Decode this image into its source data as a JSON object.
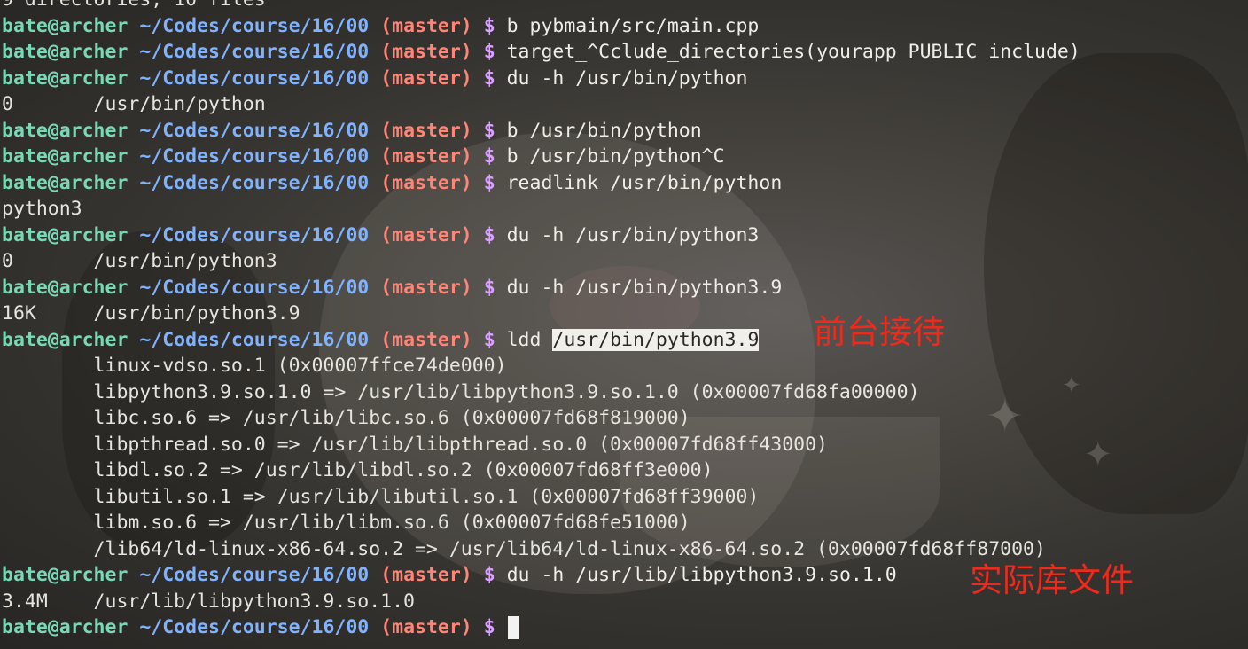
{
  "prompt": {
    "user": "bate@archer",
    "path": "~/Codes/course/16/00",
    "branch": "(master)",
    "symbol": "$"
  },
  "partial_top_line": "9 directories, 10 files",
  "lines": [
    {
      "type": "prompt",
      "cmd": "b pybmain/src/main.cpp"
    },
    {
      "type": "prompt",
      "cmd": "target_^Cclude_directories(yourapp PUBLIC include)"
    },
    {
      "type": "prompt",
      "cmd": "du -h /usr/bin/python"
    },
    {
      "type": "output",
      "text": "0       /usr/bin/python"
    },
    {
      "type": "prompt",
      "cmd": "b /usr/bin/python"
    },
    {
      "type": "prompt",
      "cmd": "b /usr/bin/python^C"
    },
    {
      "type": "prompt",
      "cmd": "readlink /usr/bin/python"
    },
    {
      "type": "output",
      "text": "python3"
    },
    {
      "type": "prompt",
      "cmd": "du -h /usr/bin/python3"
    },
    {
      "type": "output",
      "text": "0       /usr/bin/python3"
    },
    {
      "type": "prompt",
      "cmd": "du -h /usr/bin/python3.9"
    },
    {
      "type": "output",
      "text": "16K     /usr/bin/python3.9"
    },
    {
      "type": "prompt",
      "cmd": "ldd ",
      "highlight": "/usr/bin/python3.9"
    },
    {
      "type": "output",
      "text": "        linux-vdso.so.1 (0x00007ffce74de000)"
    },
    {
      "type": "output",
      "text": "        libpython3.9.so.1.0 => /usr/lib/libpython3.9.so.1.0 (0x00007fd68fa00000)"
    },
    {
      "type": "output",
      "text": "        libc.so.6 => /usr/lib/libc.so.6 (0x00007fd68f819000)"
    },
    {
      "type": "output",
      "text": "        libpthread.so.0 => /usr/lib/libpthread.so.0 (0x00007fd68ff43000)"
    },
    {
      "type": "output",
      "text": "        libdl.so.2 => /usr/lib/libdl.so.2 (0x00007fd68ff3e000)"
    },
    {
      "type": "output",
      "text": "        libutil.so.1 => /usr/lib/libutil.so.1 (0x00007fd68ff39000)"
    },
    {
      "type": "output",
      "text": "        libm.so.6 => /usr/lib/libm.so.6 (0x00007fd68fe51000)"
    },
    {
      "type": "output",
      "text": "        /lib64/ld-linux-x86-64.so.2 => /usr/lib64/ld-linux-x86-64.so.2 (0x00007fd68ff87000)"
    },
    {
      "type": "prompt",
      "cmd": "du -h /usr/lib/libpython3.9.so.1.0"
    },
    {
      "type": "output",
      "text": "3.4M    /usr/lib/libpython3.9.so.1.0"
    },
    {
      "type": "prompt",
      "cmd": "",
      "cursor": true
    }
  ],
  "annotations": [
    {
      "text": "前台接待"
    },
    {
      "text": "实际库文件"
    }
  ],
  "colors": {
    "user": "#79d9b7",
    "path": "#7fb2ff",
    "branch": "#ff8577",
    "symbol": "#d9a2ff",
    "annotation": "#ee2a1c"
  }
}
